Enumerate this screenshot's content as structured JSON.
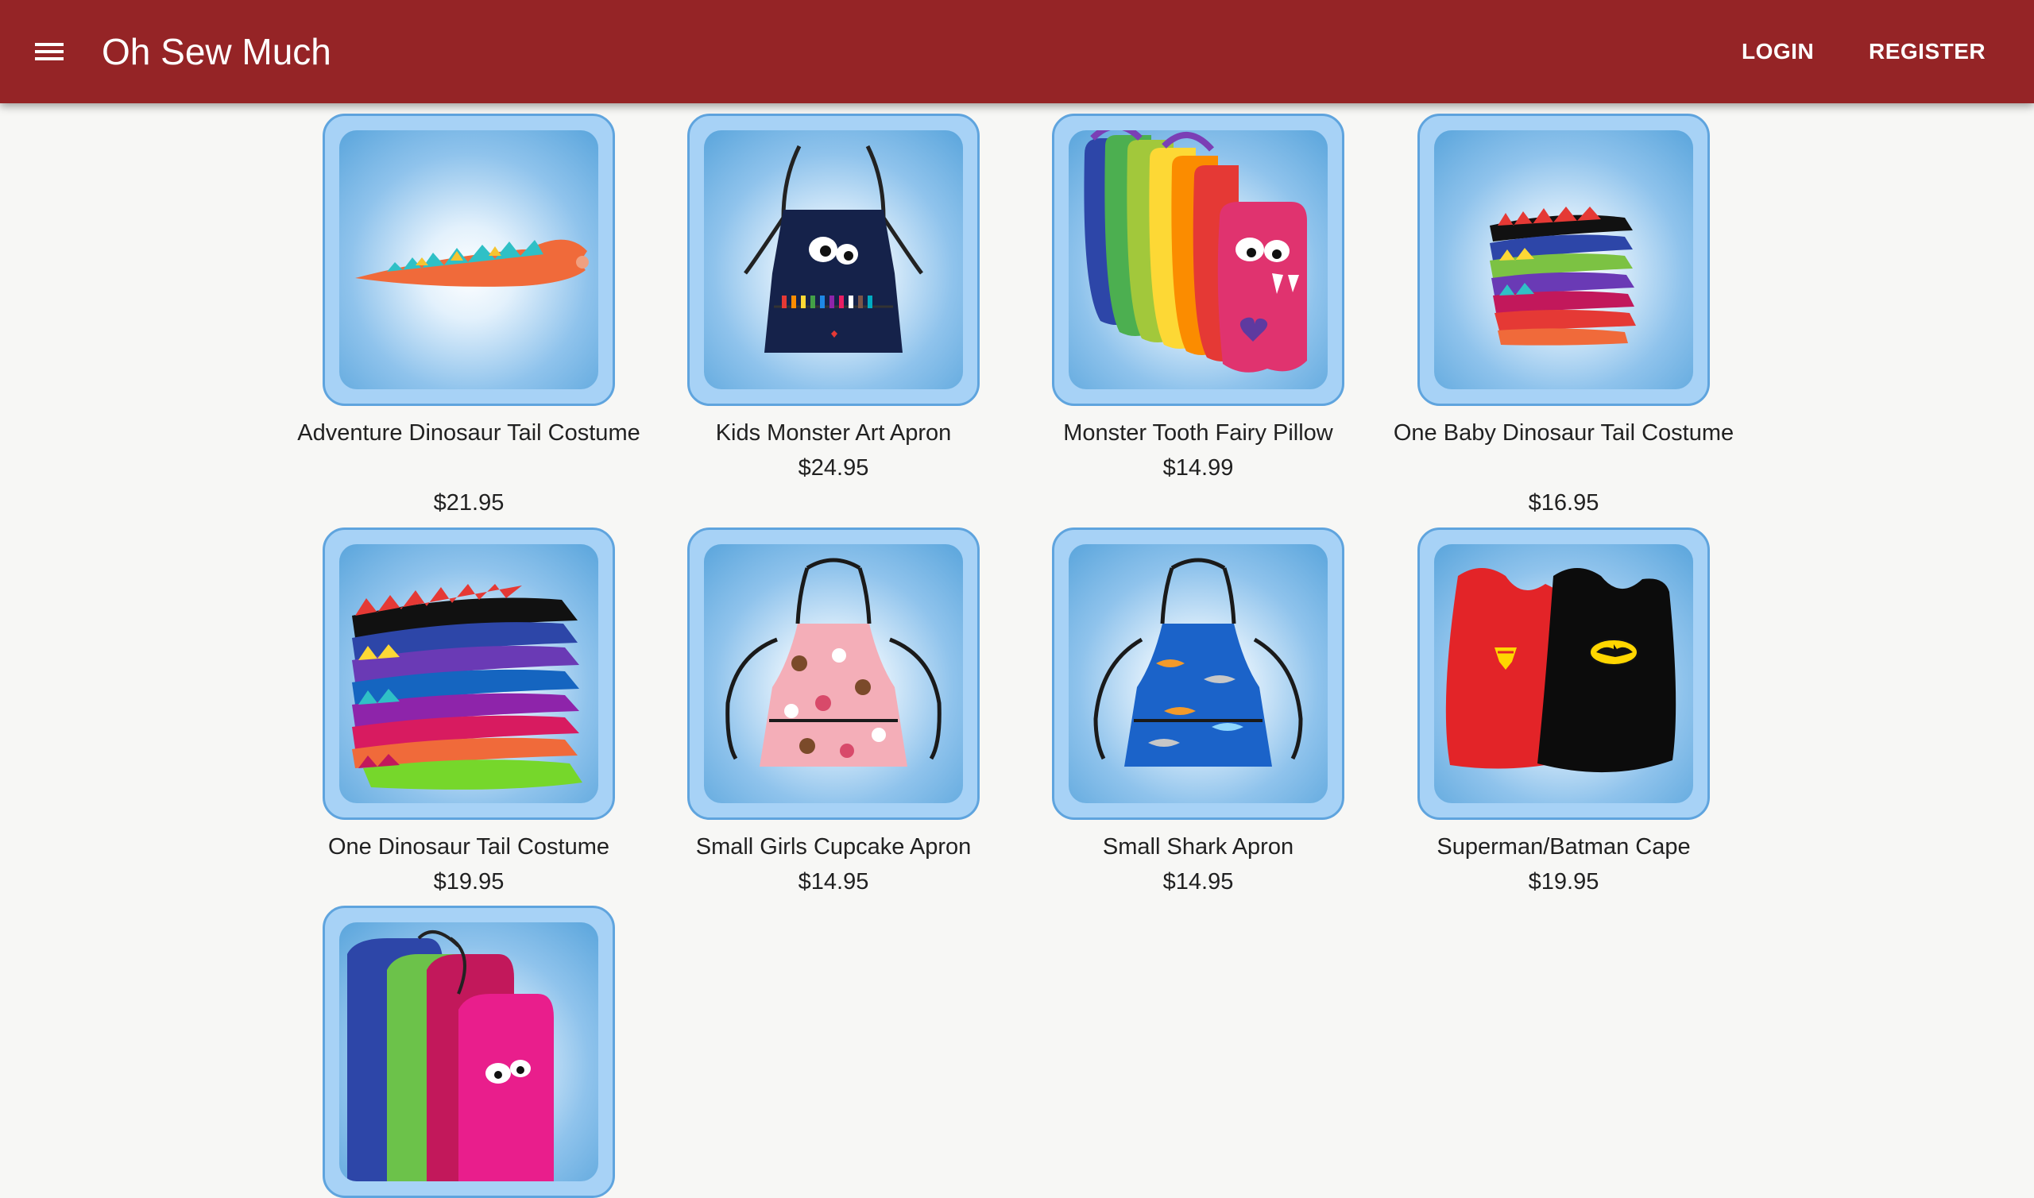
{
  "header": {
    "title": "Oh Sew Much",
    "login_label": "LOGIN",
    "register_label": "REGISTER",
    "background_color": "#952426"
  },
  "icons": {
    "menu": "hamburger-menu-icon"
  },
  "products": [
    {
      "name": "Adventure Dinosaur Tail Costume",
      "price": "$21.95"
    },
    {
      "name": "Kids Monster Art Apron",
      "price": "$24.95"
    },
    {
      "name": "Monster Tooth Fairy Pillow",
      "price": "$14.99"
    },
    {
      "name": "One Baby Dinosaur Tail Costume",
      "price": "$16.95"
    },
    {
      "name": "One Dinosaur Tail Costume",
      "price": "$19.95"
    },
    {
      "name": "Small Girls Cupcake Apron",
      "price": "$14.95"
    },
    {
      "name": "Small Shark Apron",
      "price": "$14.95"
    },
    {
      "name": "Superman/Batman Cape",
      "price": "$19.95"
    },
    {
      "name": "",
      "price": ""
    }
  ]
}
